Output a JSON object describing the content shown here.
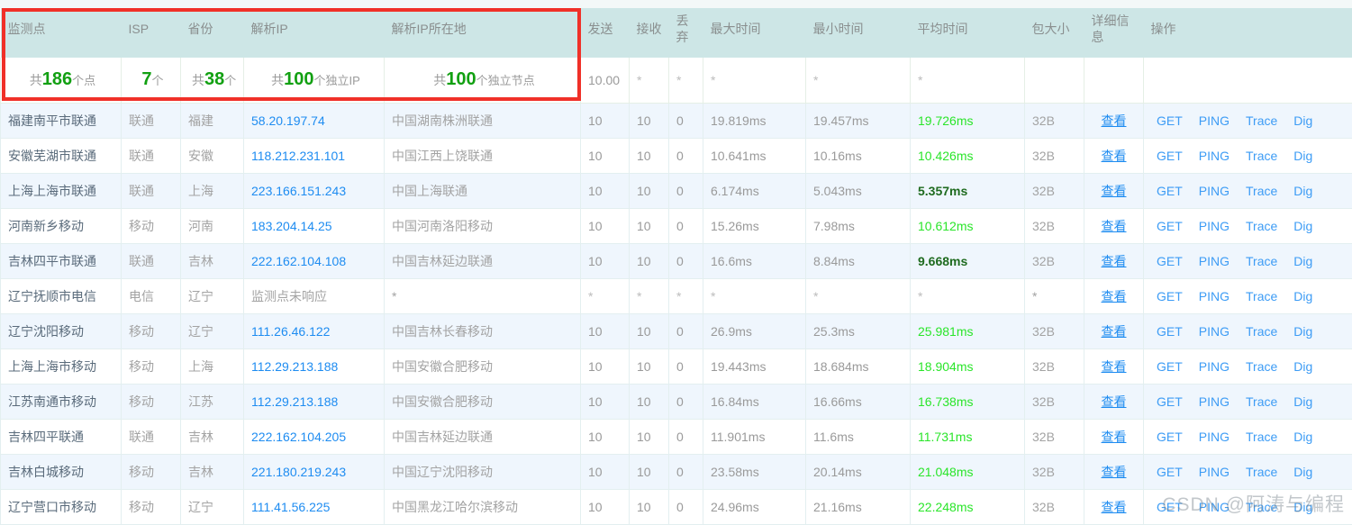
{
  "columns": [
    {
      "key": "point",
      "label": "监测点"
    },
    {
      "key": "isp",
      "label": "ISP"
    },
    {
      "key": "prov",
      "label": "省份"
    },
    {
      "key": "ip",
      "label": "解析IP"
    },
    {
      "key": "iploc",
      "label": "解析IP所在地"
    },
    {
      "key": "send",
      "label": "发送"
    },
    {
      "key": "recv",
      "label": "接收"
    },
    {
      "key": "lost",
      "label": "丢弃"
    },
    {
      "key": "max",
      "label": "最大时间"
    },
    {
      "key": "min",
      "label": "最小时间"
    },
    {
      "key": "avg",
      "label": "平均时间"
    },
    {
      "key": "size",
      "label": "包大小"
    },
    {
      "key": "detail",
      "label": "详细信息"
    },
    {
      "key": "ops",
      "label": "操作"
    }
  ],
  "summary": {
    "point": {
      "prefix": "共",
      "num": "186",
      "suffix": "个点"
    },
    "isp": {
      "prefix": "",
      "num": "7",
      "suffix": "个"
    },
    "prov": {
      "prefix": "共",
      "num": "38",
      "suffix": "个"
    },
    "ip": {
      "prefix": "共",
      "num": "100",
      "suffix": "个独立IP"
    },
    "iploc": {
      "prefix": "共",
      "num": "100",
      "suffix": "个独立节点"
    },
    "send": "10.00",
    "recv": "*",
    "lost": "*",
    "max": "*",
    "min": "*",
    "avg": "*",
    "size": "",
    "detail": "",
    "ops": ""
  },
  "ops_labels": [
    "GET",
    "PING",
    "Trace",
    "Dig"
  ],
  "detail_label": "查看",
  "rows": [
    {
      "point": "福建南平市联通",
      "isp": "联通",
      "prov": "福建",
      "ip": "58.20.197.74",
      "ip_link": true,
      "iploc": "中国湖南株洲联通",
      "send": "10",
      "recv": "10",
      "lost": "0",
      "max": "19.819ms",
      "min": "19.457ms",
      "avg": "19.726ms",
      "avg_style": "bright",
      "size": "32B"
    },
    {
      "point": "安徽芜湖市联通",
      "isp": "联通",
      "prov": "安徽",
      "ip": "118.212.231.101",
      "ip_link": true,
      "iploc": "中国江西上饶联通",
      "send": "10",
      "recv": "10",
      "lost": "0",
      "max": "10.641ms",
      "min": "10.16ms",
      "avg": "10.426ms",
      "avg_style": "bright",
      "size": "32B"
    },
    {
      "point": "上海上海市联通",
      "isp": "联通",
      "prov": "上海",
      "ip": "223.166.151.243",
      "ip_link": true,
      "iploc": "中国上海联通",
      "send": "10",
      "recv": "10",
      "lost": "0",
      "max": "6.174ms",
      "min": "5.043ms",
      "avg": "5.357ms",
      "avg_style": "dark",
      "size": "32B"
    },
    {
      "point": "河南新乡移动",
      "isp": "移动",
      "prov": "河南",
      "ip": "183.204.14.25",
      "ip_link": true,
      "iploc": "中国河南洛阳移动",
      "send": "10",
      "recv": "10",
      "lost": "0",
      "max": "15.26ms",
      "min": "7.98ms",
      "avg": "10.612ms",
      "avg_style": "bright",
      "size": "32B"
    },
    {
      "point": "吉林四平市联通",
      "isp": "联通",
      "prov": "吉林",
      "ip": "222.162.104.108",
      "ip_link": true,
      "iploc": "中国吉林延边联通",
      "send": "10",
      "recv": "10",
      "lost": "0",
      "max": "16.6ms",
      "min": "8.84ms",
      "avg": "9.668ms",
      "avg_style": "dark",
      "size": "32B"
    },
    {
      "point": "辽宁抚顺市电信",
      "isp": "电信",
      "prov": "辽宁",
      "ip": "监测点未响应",
      "ip_link": false,
      "iploc": "*",
      "send": "*",
      "recv": "*",
      "lost": "*",
      "max": "*",
      "min": "*",
      "avg": "*",
      "avg_style": "star",
      "size": "*"
    },
    {
      "point": "辽宁沈阳移动",
      "isp": "移动",
      "prov": "辽宁",
      "ip": "111.26.46.122",
      "ip_link": true,
      "iploc": "中国吉林长春移动",
      "send": "10",
      "recv": "10",
      "lost": "0",
      "max": "26.9ms",
      "min": "25.3ms",
      "avg": "25.981ms",
      "avg_style": "bright",
      "size": "32B"
    },
    {
      "point": "上海上海市移动",
      "isp": "移动",
      "prov": "上海",
      "ip": "112.29.213.188",
      "ip_link": true,
      "iploc": "中国安徽合肥移动",
      "send": "10",
      "recv": "10",
      "lost": "0",
      "max": "19.443ms",
      "min": "18.684ms",
      "avg": "18.904ms",
      "avg_style": "bright",
      "size": "32B"
    },
    {
      "point": "江苏南通市移动",
      "isp": "移动",
      "prov": "江苏",
      "ip": "112.29.213.188",
      "ip_link": true,
      "iploc": "中国安徽合肥移动",
      "send": "10",
      "recv": "10",
      "lost": "0",
      "max": "16.84ms",
      "min": "16.66ms",
      "avg": "16.738ms",
      "avg_style": "bright",
      "size": "32B"
    },
    {
      "point": "吉林四平联通",
      "isp": "联通",
      "prov": "吉林",
      "ip": "222.162.104.205",
      "ip_link": true,
      "iploc": "中国吉林延边联通",
      "send": "10",
      "recv": "10",
      "lost": "0",
      "max": "11.901ms",
      "min": "11.6ms",
      "avg": "11.731ms",
      "avg_style": "bright",
      "size": "32B"
    },
    {
      "point": "吉林白城移动",
      "isp": "移动",
      "prov": "吉林",
      "ip": "221.180.219.243",
      "ip_link": true,
      "iploc": "中国辽宁沈阳移动",
      "send": "10",
      "recv": "10",
      "lost": "0",
      "max": "23.58ms",
      "min": "20.14ms",
      "avg": "21.048ms",
      "avg_style": "bright",
      "size": "32B"
    },
    {
      "point": "辽宁营口市移动",
      "isp": "移动",
      "prov": "辽宁",
      "ip": "111.41.56.225",
      "ip_link": true,
      "iploc": "中国黑龙江哈尔滨移动",
      "send": "10",
      "recv": "10",
      "lost": "0",
      "max": "24.96ms",
      "min": "21.16ms",
      "avg": "22.248ms",
      "avg_style": "bright",
      "size": "32B"
    }
  ],
  "watermark": "CSDN @阿涛与编程",
  "colors": {
    "header_bg": "#cde6e6",
    "row_stripe": "#eff6fd",
    "link_blue": "#1e8cf1",
    "annotation_red": "#f03028",
    "avg_bright_green": "#2ae52a",
    "avg_dark_green": "#1f6b1f",
    "summary_green": "#12a012"
  }
}
